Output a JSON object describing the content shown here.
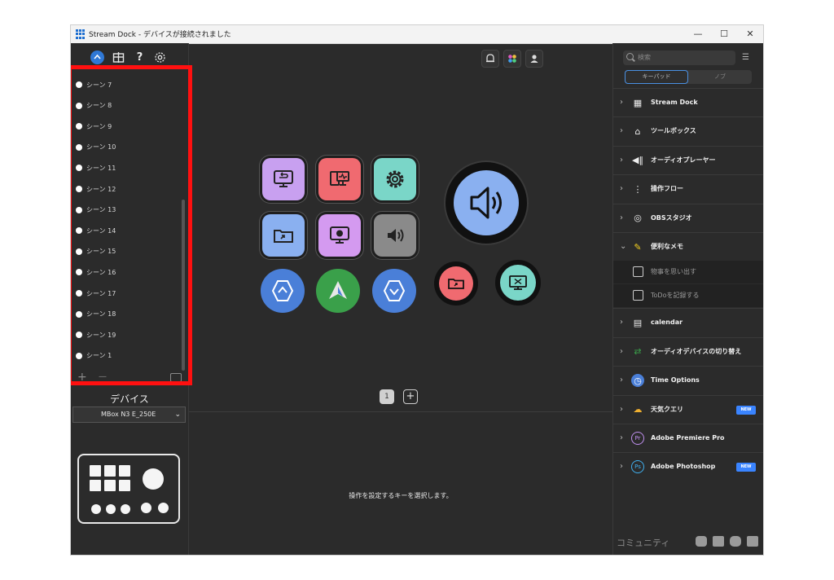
{
  "window": {
    "title": "Stream Dock - デバイスが接続されました",
    "controls": {
      "minimize": "—",
      "maximize": "☐",
      "close": "✕"
    }
  },
  "left_toolbar": {
    "icons": [
      "app-home-icon",
      "store-icon",
      "help-icon",
      "settings-icon"
    ],
    "help_glyph": "?"
  },
  "scenes": [
    "シーン 7",
    "シーン 8",
    "シーン 9",
    "シーン 10",
    "シーン 11",
    "シーン 12",
    "シーン 13",
    "シーン 14",
    "シーン 15",
    "シーン 16",
    "シーン 17",
    "シーン 18",
    "シーン 19",
    "シーン 1"
  ],
  "scene_actions": {
    "add": "+",
    "remove": "—"
  },
  "device": {
    "label": "デバイス",
    "selected": "MBox N3 E_250E"
  },
  "center": {
    "top_icons": [
      "bell-icon",
      "plugins-icon",
      "user-icon"
    ],
    "keys": [
      {
        "name": "screen-return-key",
        "color": "#c8a0f0"
      },
      {
        "name": "monitor-key",
        "color": "#f06a70"
      },
      {
        "name": "settings-key",
        "color": "#7ad6c8"
      },
      {
        "name": "folder-open-key",
        "color": "#8ab0f0"
      },
      {
        "name": "display-key",
        "color": "#d49af0"
      },
      {
        "name": "volume-key",
        "color": "#8a8a8a"
      }
    ],
    "page_number": "1",
    "add_page": "+",
    "hint": "操作を設定するキーを選択します。"
  },
  "right": {
    "search_placeholder": "検索",
    "tabs": [
      "キーパッド",
      "ノブ"
    ],
    "categories": [
      {
        "label": "Stream Dock",
        "icon": "keyboard-grid-icon",
        "expanded": false
      },
      {
        "label": "ツールボックス",
        "icon": "toolbox-icon",
        "expanded": false
      },
      {
        "label": "オーディオプレーヤー",
        "icon": "audio-player-icon",
        "expanded": false
      },
      {
        "label": "操作フロー",
        "icon": "flow-icon",
        "expanded": false
      },
      {
        "label": "OBSスタジオ",
        "icon": "obs-icon",
        "expanded": false
      },
      {
        "label": "便利なメモ",
        "icon": "memo-icon",
        "expanded": true,
        "children": [
          {
            "label": "物事を思い出す",
            "icon": "note-icon"
          },
          {
            "label": "ToDoを記録する",
            "icon": "clipboard-check-icon"
          }
        ]
      },
      {
        "label": "calendar",
        "icon": "calendar-icon",
        "expanded": false
      },
      {
        "label": "オーディオデバイスの切り替え",
        "icon": "audio-switch-icon",
        "expanded": false
      },
      {
        "label": "Time Options",
        "icon": "clock-icon",
        "expanded": false
      },
      {
        "label": "天気クエリ",
        "icon": "weather-icon",
        "expanded": false,
        "badge": "NEW"
      },
      {
        "label": "Adobe Premiere Pro",
        "icon": "premiere-icon",
        "expanded": false
      },
      {
        "label": "Adobe Photoshop",
        "icon": "photoshop-icon",
        "expanded": false,
        "badge": "NEW"
      }
    ],
    "community": "コミュニティ",
    "social_icons": [
      "discord-icon",
      "facebook-icon",
      "chat-icon",
      "mail-icon"
    ]
  },
  "colors": {
    "background": "#2b2b2b",
    "accent": "#3a84ff",
    "highlight_box": "#ff1010"
  }
}
